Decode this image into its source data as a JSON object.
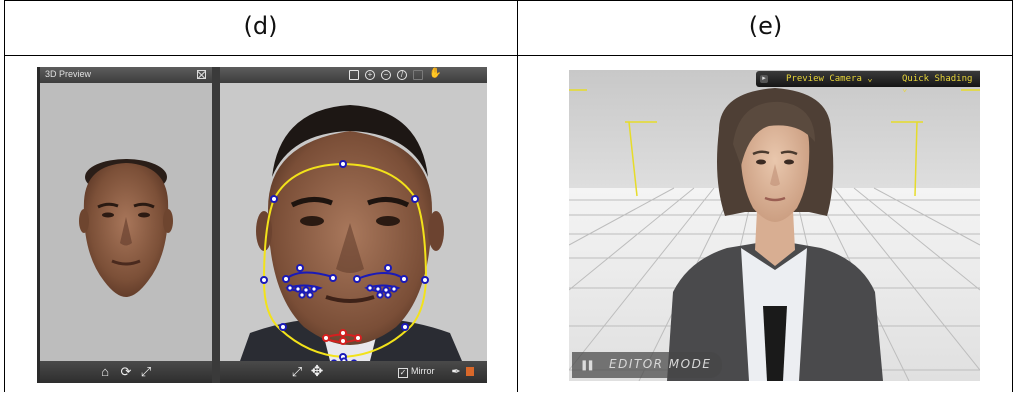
{
  "captions": {
    "left": "(d)",
    "right": "(e)"
  },
  "face_editor": {
    "preview_title": "3D Preview",
    "toolbar_icons": [
      "zoom-region-icon",
      "zoom-in-icon",
      "zoom-out-icon",
      "reset-icon",
      "fit-icon",
      "pan-hand-icon"
    ],
    "preview_bottom_icons": [
      "home-icon",
      "rotate-icon",
      "fullscreen-icon"
    ],
    "editor_bottom_icons": [
      "fullscreen-icon",
      "move-icon"
    ],
    "mirror_label": "Mirror",
    "mirror_checked": true,
    "colors": {
      "outline": "#f2e21a",
      "landmark": "#1a1ab8",
      "nose_landmark": "#d42020",
      "swatch": "#d9682a"
    }
  },
  "avatar_viewer": {
    "camera_dropdown": "Preview Camera",
    "shading_dropdown": "Quick Shading",
    "mode_label": "EDITOR MODE",
    "colors": {
      "accent": "#e8d63a"
    }
  }
}
